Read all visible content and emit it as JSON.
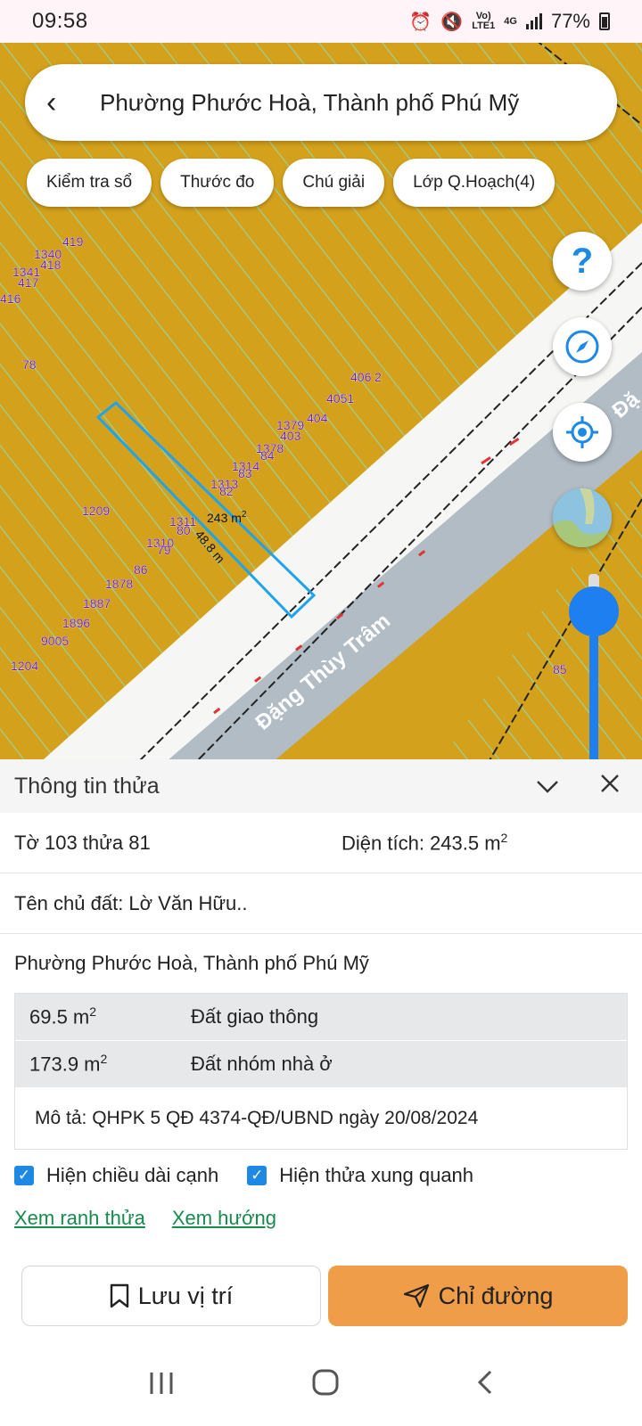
{
  "status": {
    "time": "09:58",
    "network_top": "Vo)",
    "network_bottom": "LTE1",
    "gen": "4G",
    "battery": "77%"
  },
  "search": {
    "title": "Phường Phước Hoà, Thành phố Phú Mỹ"
  },
  "chips": [
    "Kiểm tra sổ",
    "Thước đo",
    "Chú giải",
    "Lớp Q.Hoạch(4)"
  ],
  "fab": {
    "help": "?"
  },
  "map": {
    "road_name": "Đặng Thùy Trâm",
    "road_name_partial": "Đặ",
    "area_label": "243 m",
    "area_sup": "2",
    "length_label": "48.8 m",
    "parcel_numbers": [
      "419",
      "1340",
      "418",
      "1341",
      "417",
      "416",
      "78",
      "406",
      "2",
      "4051",
      "1379",
      "404",
      "403",
      "1378",
      "1314",
      "84",
      "83",
      "1313",
      "82",
      "1209",
      "1311",
      "80",
      "1310",
      "79",
      "86",
      "1878",
      "1887",
      "1896",
      "9005",
      "1204",
      "85"
    ]
  },
  "panel": {
    "title": "Thông tin thửa",
    "sheet": "Tờ 103 thửa 81",
    "area_label": "Diện tích: 243.5 m",
    "area_sup": "2",
    "owner": "Tên chủ đất: Lờ Văn Hữu..",
    "address": "Phường Phước Hoà, Thành phố Phú Mỹ",
    "land_rows": [
      {
        "area": "69.5 m",
        "sup": "2",
        "type": "Đất giao thông"
      },
      {
        "area": "173.9 m",
        "sup": "2",
        "type": "Đất nhóm nhà ở"
      }
    ],
    "description": "Mô tả: QHPK 5 QĐ 4374-QĐ/UBND ngày 20/08/2024",
    "check_edge_length": "Hiện chiều dài cạnh",
    "check_neighbors": "Hiện thửa xung quanh",
    "link_boundary": "Xem ranh thửa",
    "link_direction": "Xem hướng",
    "save_label": "Lưu vị trí",
    "route_label": "Chỉ đường"
  },
  "colors": {
    "map_land": "#d3a11c",
    "map_lines": "#7fe8d2",
    "road": "#a9b3bd",
    "accent_blue": "#1e7ff0",
    "route_button": "#ef9d48",
    "link_green": "#188a4e"
  }
}
